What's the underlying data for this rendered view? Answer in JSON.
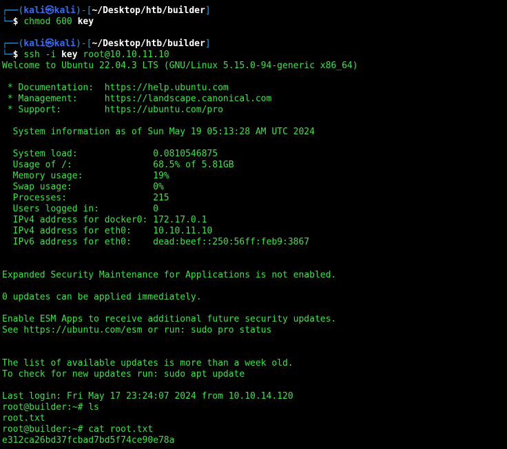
{
  "prompt": {
    "box_top": "┌──(",
    "user": "kali",
    "at": "㉿",
    "host": "kali",
    "close": ")-[",
    "cwd": "~/Desktop/htb/builder",
    "box_end": "]",
    "box_bottom": "└─",
    "dollar": "$ "
  },
  "cmd1": {
    "name": "chmod",
    "args": " 600 ",
    "file": "key"
  },
  "cmd2": {
    "name": "ssh",
    "args": " -i ",
    "file": "key",
    "target": " root@10.10.11.10"
  },
  "motd": {
    "welcome": "Welcome to Ubuntu 22.04.3 LTS (GNU/Linux 5.15.0-94-generic x86_64)",
    "doc": " * Documentation:  https://help.ubuntu.com",
    "mgmt": " * Management:     https://landscape.canonical.com",
    "support": " * Support:        https://ubuntu.com/pro",
    "sysinfo": "  System information as of Sun May 19 05:13:28 AM UTC 2024",
    "stats": [
      "  System load:              0.0810546875",
      "  Usage of /:               68.5% of 5.81GB",
      "  Memory usage:             19%",
      "  Swap usage:               0%",
      "  Processes:                215",
      "  Users logged in:          0",
      "  IPv4 address for docker0: 172.17.0.1",
      "  IPv4 address for eth0:    10.10.11.10",
      "  IPv6 address for eth0:    dead:beef::250:56ff:feb9:3867"
    ],
    "esm": "Expanded Security Maintenance for Applications is not enabled.",
    "updates": "0 updates can be applied immediately.",
    "esm_apps": "Enable ESM Apps to receive additional future security updates.",
    "esm_see": "See https://ubuntu.com/esm or run: sudo pro status",
    "old1": "The list of available updates is more than a week old.",
    "old2": "To check for new updates run: sudo apt update",
    "last_login": "Last login: Fri May 17 23:24:07 2024 from 10.10.14.120"
  },
  "root_session": {
    "p1": "root@builder:~# ls",
    "o1": "root.txt",
    "p2": "root@builder:~# cat root.txt",
    "flag": "e312ca26bd37fcbad7bd5f74ce90e78a"
  }
}
